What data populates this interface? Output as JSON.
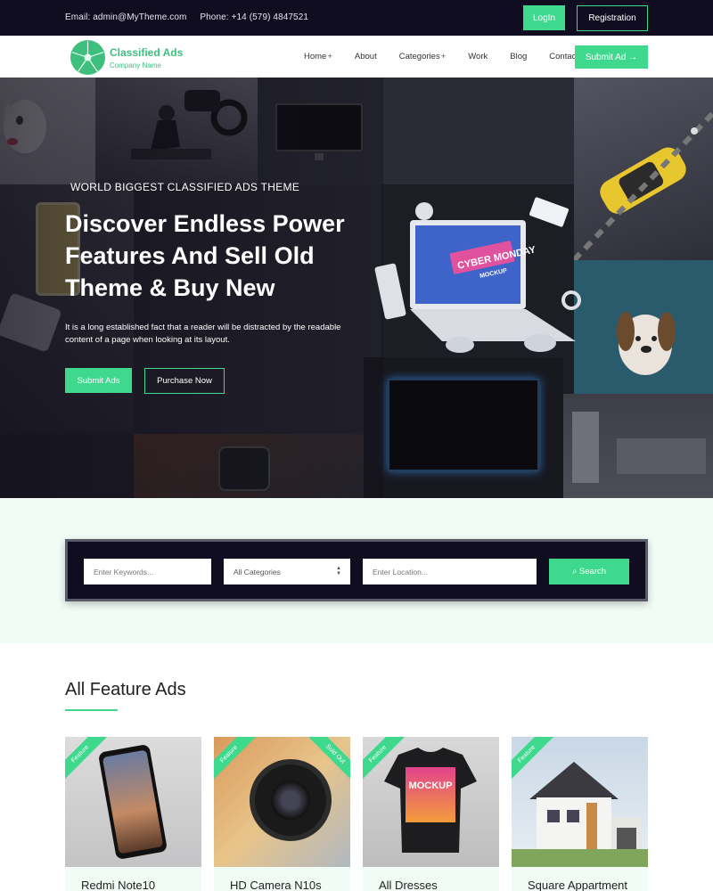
{
  "topbar": {
    "email": "Email: admin@MyTheme.com",
    "phone": "Phone: +14 (579) 4847521",
    "login_label": "LogIn",
    "registration_label": "Registration"
  },
  "brand": {
    "name": "Classified Ads",
    "tagline": "Company Name"
  },
  "nav": {
    "items": [
      {
        "label": "Home",
        "has_submenu": true
      },
      {
        "label": "About",
        "has_submenu": false
      },
      {
        "label": "Categories",
        "has_submenu": true
      },
      {
        "label": "Work",
        "has_submenu": false
      },
      {
        "label": "Blog",
        "has_submenu": false
      },
      {
        "label": "Contact",
        "has_submenu": false
      }
    ],
    "submenu_glyph": "+",
    "submit_ad_label": "Submit Ad →"
  },
  "hero": {
    "kicker": "WORLD BIGGEST CLASSIFIED ADS THEME",
    "title": "Discover Endless Power Features And Sell Old Theme & Buy New",
    "text": "It is a long established fact that a reader will be distracted by the readable content of a page when looking at its layout.",
    "submit_label": "Submit Ads",
    "purchase_label": "Purchase Now",
    "laptop_screen_text": "CYBER MONDAY",
    "laptop_screen_sub": "MOCKUP"
  },
  "search": {
    "keywords_placeholder": "Enter Keywords...",
    "category_selected": "All Categories",
    "location_placeholder": "Enter Location...",
    "search_label": "⌕ Search"
  },
  "featured": {
    "title": "All Feature Ads",
    "cards": [
      {
        "name": "Redmi Note10",
        "badge": "Feature",
        "status": ""
      },
      {
        "name": "HD Camera N10s",
        "badge": "Feature",
        "status": "Sold Out"
      },
      {
        "name": "All Dresses",
        "badge": "Feature",
        "status": "",
        "shirt_text": "MOCKUP"
      },
      {
        "name": "Square Appartment",
        "badge": "Feature",
        "status": ""
      }
    ]
  },
  "colors": {
    "accent": "#3fd98e",
    "dark": "#0f0d1f",
    "light_bg": "#f2fcf6"
  }
}
